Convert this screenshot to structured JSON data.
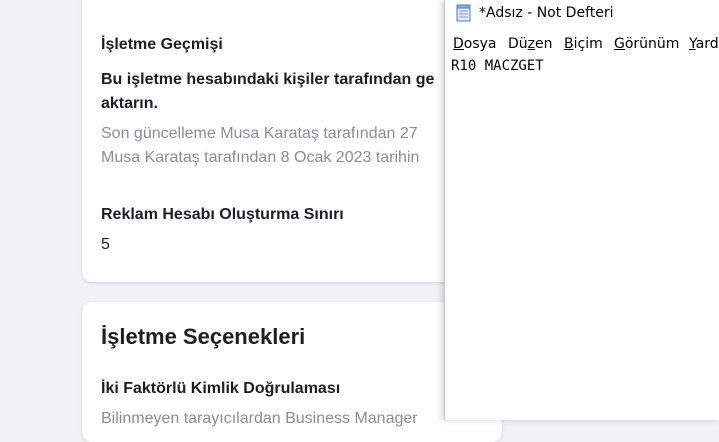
{
  "background_page": {
    "business_history_title": "İşletme Geçmişi",
    "transfer_text": "Bu işletme hesabındaki kişiler tarafından ge",
    "transfer_text_line2": "aktarın.",
    "updated_line1": "Son güncelleme Musa Karataş tarafından 27",
    "updated_line2": "Musa Karataş tarafından 8 Ocak 2023 tarihin",
    "ad_account_limit_label": "Reklam Hesabı Oluşturma Sınırı",
    "ad_account_limit_value": "5",
    "business_options_title": "İşletme Seçenekleri",
    "two_factor_title": "İki Faktörlü Kimlik Doğrulaması",
    "two_factor_desc": "Bilinmeyen tarayıcılardan Business Manager"
  },
  "notepad": {
    "title": "*Adsız - Not Defteri",
    "menu": [
      {
        "mnemonic": "D",
        "rest": "osya"
      },
      {
        "mnemonic": "Dü",
        "rest": "zen",
        "underline_index": 2
      },
      {
        "mnemonic": "B",
        "rest": "içim"
      },
      {
        "mnemonic": "G",
        "rest": "örünüm"
      },
      {
        "mnemonic": "Y",
        "rest": "ard"
      }
    ],
    "content": "R10 MACZGET",
    "icon": "notepad-icon"
  }
}
